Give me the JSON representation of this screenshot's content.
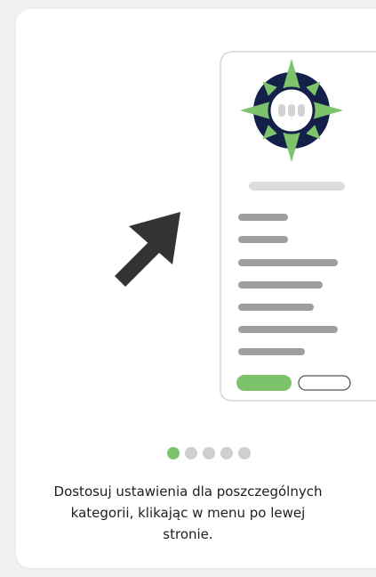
{
  "colors": {
    "accent_green": "#7dc36b",
    "navy": "#14204a",
    "arrow": "#333333",
    "bar_gray": "#9e9e9e",
    "bar_light": "#dcdcdc",
    "dot_inactive": "#cfcfcf"
  },
  "illustration": {
    "arrow_icon": "arrow-up-right-icon",
    "logo_icon": "compass-logo-icon"
  },
  "pagination": {
    "total": 5,
    "active_index": 0
  },
  "caption": "Dostosuj ustawienia dla poszczególnych\nkategorii, klikając w menu po lewej\nstronie."
}
